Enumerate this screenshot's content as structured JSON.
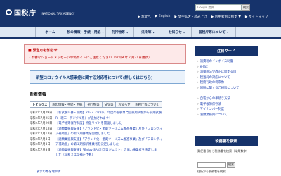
{
  "header": {
    "logo_jp": "国税庁",
    "logo_en": "NATIONAL TAX AGENCY",
    "search_placeholder": "Google 提供",
    "search_button": "検索",
    "utility": [
      "▶ 本文へ",
      "▶ English",
      "▶ 文字拡大・読み上げ",
      "▶ 利用者別に探す ▼",
      "▶ サイトマップ"
    ]
  },
  "nav": {
    "items": [
      "ホーム",
      "税の情報・手続・用紙",
      "刊行物等",
      "法令等",
      "お知らせ",
      "国税庁等について"
    ]
  },
  "alert": {
    "title": "緊急のお知らせ",
    "line": "・不審なショートメッセージや偽サイトにご注意ください（令和４年７月21日更新）"
  },
  "banner": {
    "text": "新型コロナウイルス感染症に関する対応等について(詳しくはこちら)"
  },
  "news": {
    "title": "新着情報",
    "tabs": [
      "トピックス",
      "税の情報・手続・用紙",
      "刊行物等",
      "法令等",
      "お知らせ",
      "国税庁等について"
    ],
    "items": [
      {
        "date": "令和4年7月29日",
        "text": "【新試験公募・開始】2023（令和5）年度の国税専門官採用試験から前期試験"
      },
      {
        "date": "令和4年7月25日",
        "text": "R（理工・デジタル系）が追加されます！"
      },
      {
        "date": "令和4年7月26日",
        "text": "【電子帳簿保存制度】特設サイトを開設しました"
      },
      {
        "date": "令和4年7月13日",
        "text": "【酒類業振興支援】「ブランド化・酒蔵ツーリズム推進事業」及び「フロンティ"
      },
      {
        "date": "令和4年7月13日",
        "text": "ア補助金」の第２期募集を開始しました"
      },
      {
        "date": "令和4年7月8日",
        "text": "【酒類業振興支援】「ブランド化・酒蔵ツーリズム推進事業」及び「フロンティ"
      },
      {
        "date": "令和4年7月8日",
        "text": "ア補助金」の第１期採択事業者を決定しました"
      },
      {
        "date": "令和4年7月8日",
        "text": "【酒類業振興支援】「Enjoy SAKE!プロジェクト」の協力事業者を決定しま"
      },
      {
        "date": "",
        "text": "した（令和２年度補正予算）"
      }
    ],
    "more": "表示の数を増やす"
  },
  "sidebar": {
    "title": "注目ワード",
    "items": [
      "消費税のインボイス制度",
      "e-Tax",
      "消費税法令改正に関する国",
      "税当局の対応について",
      "税務行政の将来像",
      "国税に関するご相談について",
      "",
      "自宅からの手続き方法",
      "電子帳簿保存法",
      "マイナンバー制度",
      "酒類業振興について"
    ],
    "search_title": "税務署を検索",
    "search_text": "郵便番号から税務署を検索（半角数字）",
    "search_button": "検索",
    "search_sub": "住所から税務署を検索"
  }
}
